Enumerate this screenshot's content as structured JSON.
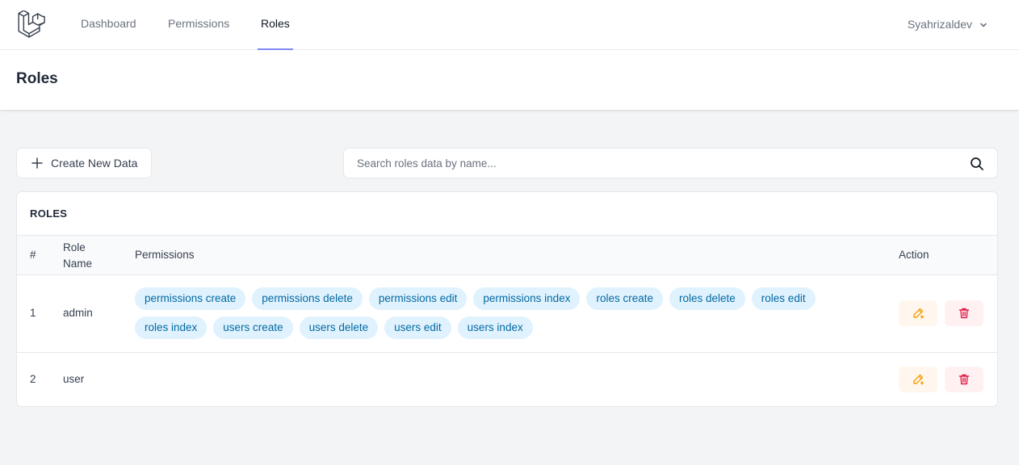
{
  "nav": {
    "links": [
      {
        "label": "Dashboard",
        "active": false
      },
      {
        "label": "Permissions",
        "active": false
      },
      {
        "label": "Roles",
        "active": true
      }
    ],
    "user": "Syahrizaldev",
    "accent_color": "#818cf8"
  },
  "page": {
    "title": "Roles"
  },
  "toolbar": {
    "create_label": "Create New Data",
    "search_placeholder": "Search roles data by name..."
  },
  "table": {
    "title": "ROLES",
    "headers": {
      "index": "#",
      "role_name_line1": "Role",
      "role_name_line2": "Name",
      "permissions": "Permissions",
      "action": "Action"
    },
    "rows": [
      {
        "index": "1",
        "name": "admin",
        "permissions": [
          "permissions create",
          "permissions delete",
          "permissions edit",
          "permissions index",
          "roles create",
          "roles delete",
          "roles edit",
          "roles index",
          "users create",
          "users delete",
          "users edit",
          "users index"
        ]
      },
      {
        "index": "2",
        "name": "user",
        "permissions": []
      }
    ]
  },
  "colors": {
    "badge_bg": "#e0f2fe",
    "badge_text": "#0369a1",
    "edit": "#f59e0b",
    "delete": "#e11d48"
  },
  "icons": [
    "app-logo-icon",
    "chevron-down-icon",
    "plus-icon",
    "search-icon",
    "pencil-edit-icon",
    "trash-icon"
  ]
}
